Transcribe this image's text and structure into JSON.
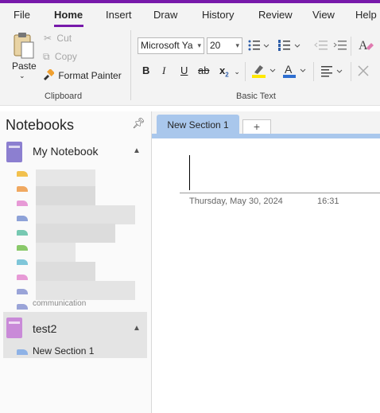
{
  "menu": {
    "items": [
      "File",
      "Home",
      "Insert",
      "Draw",
      "History",
      "Review",
      "View",
      "Help"
    ],
    "active": "Home"
  },
  "clipboard": {
    "paste_label": "Paste",
    "cut_label": "Cut",
    "copy_label": "Copy",
    "format_painter_label": "Format Painter",
    "group_label": "Clipboard"
  },
  "basic_text": {
    "font_name": "Microsoft Ya",
    "font_size": "20",
    "bold": "B",
    "italic": "I",
    "underline": "U",
    "strikethrough": "ab",
    "subscript": "x",
    "subscript_mark": "2",
    "font_color_letter": "A",
    "group_label": "Basic Text"
  },
  "colors": {
    "accent": "#7719aa",
    "highlight": "#ffe800",
    "font_color": "#2f6fd0",
    "section_tab": "#a9c7ec",
    "notebook_my": "#8c7fd0",
    "notebook_test2": "#c98ad8"
  },
  "sidebar": {
    "title": "Notebooks",
    "pin_icon": "pin-icon",
    "notebooks": [
      {
        "name": "My Notebook",
        "expanded": true
      },
      {
        "name": "test2",
        "expanded": true,
        "sections": [
          "New Section 1"
        ]
      }
    ],
    "blurred_section_colors": [
      "#f2c14e",
      "#f0a860",
      "#e79ad6",
      "#8ea2d8",
      "#77c9b2",
      "#8ac96a",
      "#7fc6d9",
      "#e79ad6",
      "#9aa4d8",
      "#9aa4d8"
    ],
    "partial_label": "communication"
  },
  "tabs": {
    "active_section": "New Section 1",
    "add_label": "+"
  },
  "page": {
    "date": "Thursday, May 30, 2024",
    "time": "16:31"
  }
}
